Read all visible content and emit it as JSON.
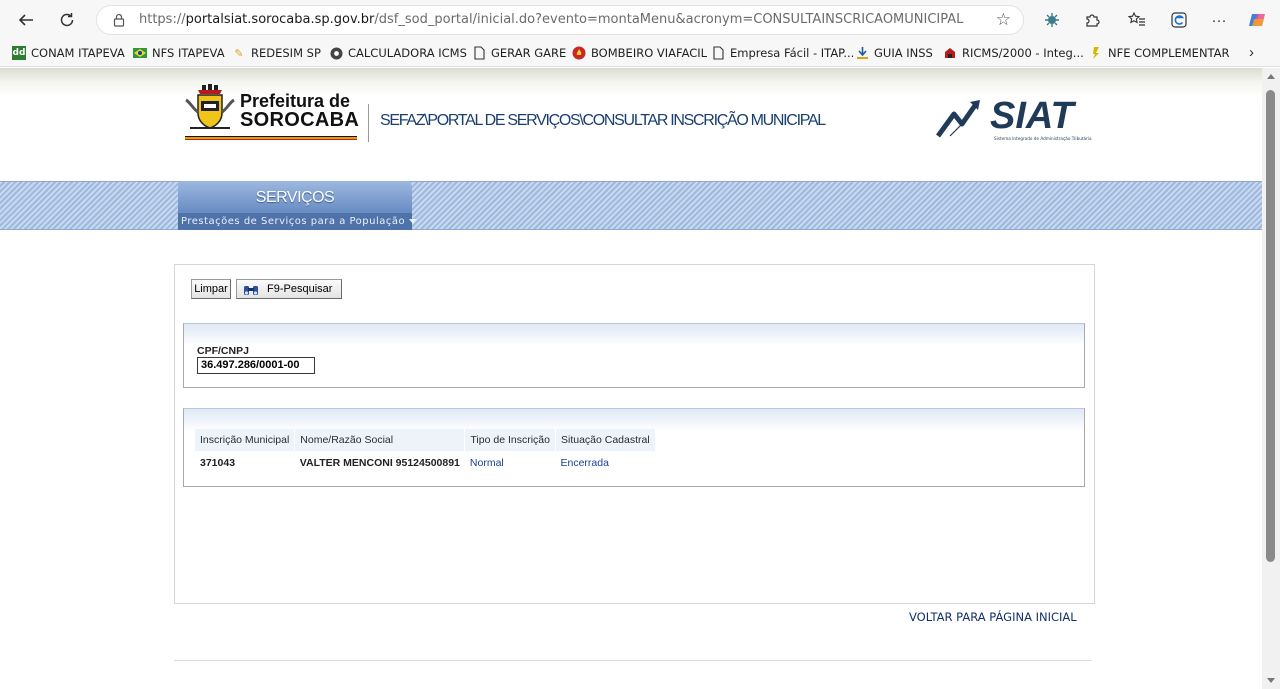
{
  "browser": {
    "url_prefix": "https://",
    "url_host": "portalsiat.sorocaba.sp.gov.br",
    "url_path": "/dsf_sod_portal/inicial.do?evento=montaMenu&acronym=CONSULTAINSCRICAOMUNICIPAL",
    "icons": [
      "back-icon",
      "refresh-icon",
      "lock-icon",
      "favorite-star-icon",
      "extension-icon",
      "puzzle-icon",
      "favorites-icon",
      "browser-essentials-icon",
      "more-icon",
      "copilot-icon"
    ]
  },
  "bookmarks": [
    {
      "label": "CONAM ITAPEVA",
      "icon": "conam-icon"
    },
    {
      "label": "NFS ITAPEVA",
      "icon": "brazil-flag-icon"
    },
    {
      "label": "REDESIM SP",
      "icon": "pencil-icon"
    },
    {
      "label": "CALCULADORA ICMS",
      "icon": "chrome-icon"
    },
    {
      "label": "GERAR GARE",
      "icon": "page-icon"
    },
    {
      "label": "BOMBEIRO VIAFACIL",
      "icon": "fire-icon"
    },
    {
      "label": "Empresa Fácil - ITAP...",
      "icon": "page-icon"
    },
    {
      "label": "GUIA INSS",
      "icon": "inss-icon"
    },
    {
      "label": "RICMS/2000 - Integ...",
      "icon": "sp-icon"
    },
    {
      "label": "NFE COMPLEMENTAR",
      "icon": "nfe-icon"
    }
  ],
  "header": {
    "logo_line1": "Prefeitura de",
    "logo_line2": "SOROCABA",
    "breadcrumb": "SEFAZ\\PORTAL DE SERVIÇOS\\CONSULTAR INSCRIÇÃO MUNICIPAL",
    "siat_logo": "SIAT",
    "siat_tagline": "Sistema Integrado de Administração Tributária"
  },
  "menu": {
    "title": "SERVIÇOS",
    "subtitle": "Prestações de Serviços para a População"
  },
  "toolbar": {
    "clear_label": "Limpar",
    "search_label": "F9-Pesquisar"
  },
  "filter": {
    "cpf_label": "CPF/CNPJ",
    "cpf_value": "36.497.286/0001-00"
  },
  "results": {
    "columns": [
      "Inscrição Municipal",
      "Nome/Razão Social",
      "Tipo de Inscrição",
      "Situação Cadastral"
    ],
    "rows": [
      [
        "371043",
        "VALTER MENCONI 95124500891",
        "Normal",
        "Encerrada"
      ]
    ]
  },
  "footer": {
    "back_label": "VOLTAR PARA PÁGINA INICIAL"
  },
  "colors": {
    "link": "#1a3f8f",
    "menu_blue": "#6b8fc5",
    "breadcrumb": "#1a3f6f"
  }
}
